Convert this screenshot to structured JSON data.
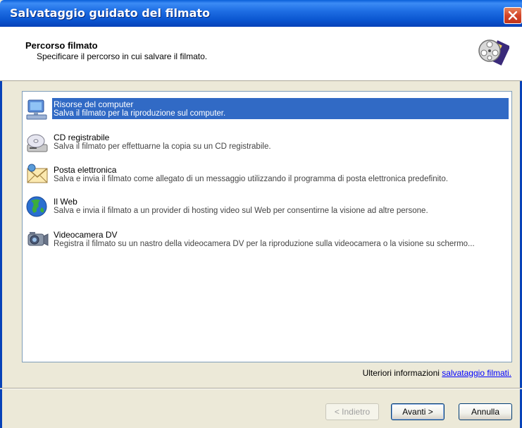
{
  "window": {
    "title": "Salvataggio guidato del filmato"
  },
  "header": {
    "title": "Percorso filmato",
    "subtitle": "Specificare il percorso in cui salvare il filmato.",
    "icon": "film-reel-icon"
  },
  "options": [
    {
      "name": "Risorse del computer",
      "desc": "Salva il filmato per la riproduzione sul computer.",
      "icon": "computer-icon",
      "selected": true
    },
    {
      "name": "CD registrabile",
      "desc": "Salva il filmato per effettuarne la copia su un CD registrabile.",
      "icon": "cd-drive-icon",
      "selected": false
    },
    {
      "name": "Posta elettronica",
      "desc": "Salva e invia il filmato come allegato di un messaggio utilizzando il programma di posta elettronica predefinito.",
      "icon": "email-envelope-icon",
      "selected": false
    },
    {
      "name": "Il Web",
      "desc": "Salva e invia il filmato a un provider di hosting video sul Web per consentirne la visione ad altre persone.",
      "icon": "globe-icon",
      "selected": false
    },
    {
      "name": "Videocamera DV",
      "desc": "Registra il filmato su un nastro della videocamera DV per la riproduzione sulla videocamera o la visione su schermo...",
      "icon": "camcorder-icon",
      "selected": false
    }
  ],
  "more_info": {
    "text": "Ulteriori informazioni",
    "link": "salvataggio filmati."
  },
  "buttons": {
    "back": "< Indietro",
    "next": "Avanti >",
    "cancel": "Annulla"
  },
  "colors": {
    "titlebar": "#0a55d0",
    "selection": "#316ac5",
    "dialog_bg": "#ece9d8"
  }
}
